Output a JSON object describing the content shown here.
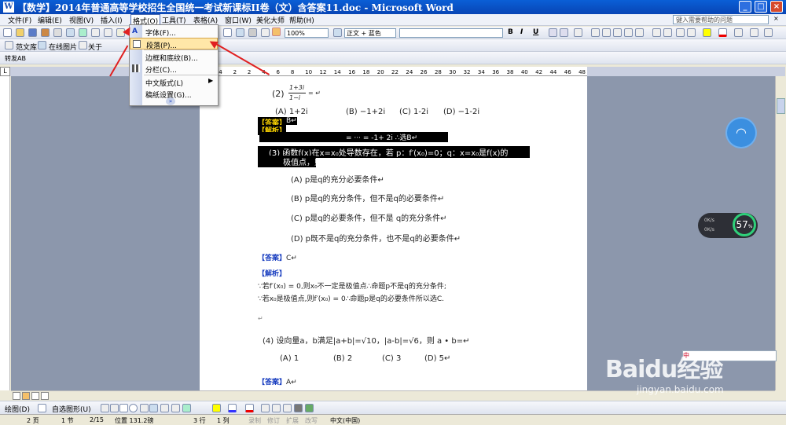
{
  "window": {
    "title": "【数学】2014年普通高等学校招生全国统一考试新课标II卷（文）含答案11.doc - Microsoft Word",
    "icon": "word-icon",
    "controls": [
      "_",
      "□",
      "×"
    ]
  },
  "menubar": {
    "items": [
      "文件(F)",
      "编辑(E)",
      "视图(V)",
      "插入(I)",
      "格式(O)",
      "工具(T)",
      "表格(A)",
      "窗口(W)",
      "美化大师",
      "帮助(H)"
    ],
    "help_placeholder": "键入需要帮助的问题"
  },
  "toolbar": {
    "zoom": "100%",
    "style": "正文 + 蓝色",
    "font_buttons": [
      "B",
      "I",
      "U"
    ]
  },
  "toolbar2": {
    "items": [
      "范文库",
      "在线图片",
      "关于"
    ],
    "convert": "转发AB"
  },
  "format_menu": {
    "items": [
      {
        "label": "字体(F)...",
        "icon": "font-icon"
      },
      {
        "label": "段落(P)...",
        "icon": "paragraph-icon",
        "highlighted": true
      },
      {
        "label": "边框和底纹(B)...",
        "icon": ""
      },
      {
        "label": "分栏(C)...",
        "icon": "columns-icon"
      },
      {
        "label": "中文版式(L)",
        "icon": "",
        "submenu": true
      },
      {
        "label": "稿纸设置(G)...",
        "icon": ""
      }
    ],
    "more": "»"
  },
  "ruler": {
    "numbers": [
      "6",
      "4",
      "2",
      "2",
      "4",
      "6",
      "8",
      "10",
      "12",
      "14",
      "16",
      "18",
      "20",
      "22",
      "24",
      "26",
      "28",
      "30",
      "32",
      "34",
      "36",
      "38",
      "40",
      "42",
      "44",
      "46",
      "48"
    ]
  },
  "document": {
    "q2_label": "(2)",
    "q2_num": "1+3i",
    "q2_den": "1−i",
    "q2_eq": "= ↵",
    "q2_options": [
      "(A)  1+2i",
      "(B)  −1+2i",
      "(C)  1-2i",
      "(D)  −1-2i"
    ],
    "ans1_tag": "【答案】",
    "ans1_val": "B↵",
    "expl1_tag": "【解析】",
    "expl1_text": "= ··· = -1+ 2i ∴选B↵",
    "q3_line1": "(3) 函数f(x)在x=x₀处导数存在，若 p：f′(x₀)=0；q：x=x₀是f(x)的",
    "q3_line2": "极值点，则↵",
    "q3_options": [
      "(A)  p是q的充分必要条件↵",
      "(B)  p是q的充分条件，但不是q的必要条件↵",
      "(C)  p是q的必要条件，但不是 q的充分条件↵",
      "(D)  p既不是q的充分条件，也不是q的必要条件↵"
    ],
    "ans2_tag": "【答案】",
    "ans2_val": "C↵",
    "expl2_tag": "【解析】",
    "expl2_line1": "∵若f′(x₀) = 0,则x₀不一定是极值点∴命题p不是q的充分条件;",
    "expl2_line2": "∵若x₀是极值点,则f′(x₀) = 0∴命题p是q的必要条件所以选C.",
    "empty_para": "↵",
    "q4_line": "(4) 设向量a，b满足|a+b|=√10，|a-b|=√6，则 a • b=↵",
    "q4_options": [
      "(A) 1",
      "(B)  2",
      "(C) 3",
      "(D) 5↵"
    ],
    "ans3_tag": "【答案】",
    "ans3_val": "A↵"
  },
  "drawbar": {
    "draw": "绘图(D)",
    "autoshape": "自选图形(U)"
  },
  "statusbar": {
    "page": "2 页",
    "section": "1 节",
    "pages": "2/15",
    "position": "位置 131.2磅",
    "line": "3 行",
    "col": "1 列",
    "rec": "录制",
    "trk": "修订",
    "ext": "扩展",
    "ovr": "改写",
    "lang": "中文(中国)"
  },
  "overlay": {
    "speed_value": "57",
    "speed_unit": "%",
    "speed_up": "0K/s",
    "speed_down": "0K/s",
    "baidu_text": "Baidu经验",
    "baidu_url": "jingyan.baidu.com",
    "ime_label": "中"
  }
}
